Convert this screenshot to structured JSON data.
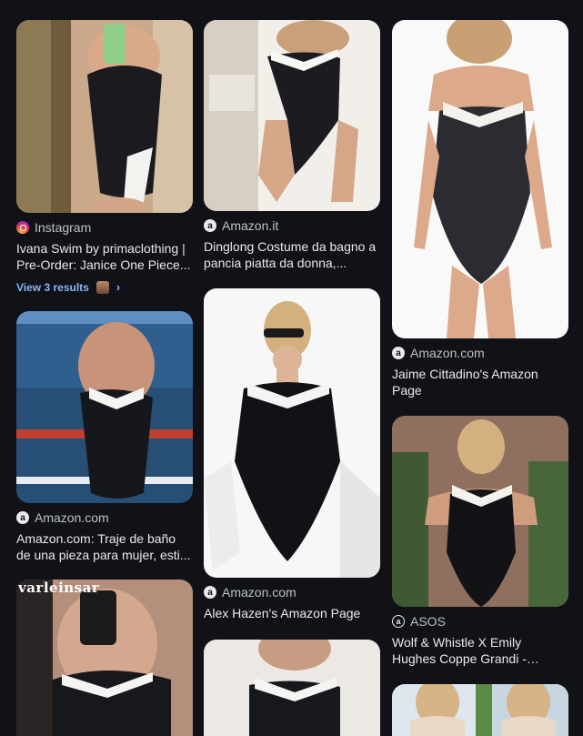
{
  "results": [
    {
      "source": "Instagram",
      "source_icon": "instagram-icon",
      "title": "Ivana Swim by primaclothing | Pre-Order: Janice One Piece...",
      "more": "View 3 results"
    },
    {
      "source": "Amazon.com",
      "source_icon": "amazon-icon",
      "title": "Amazon.com: Traje de baño de una pieza para mujer, esti..."
    },
    {
      "overlay": "varleinsar"
    },
    {
      "source": "Amazon.it",
      "source_icon": "amazon-icon",
      "title": "Dinglong Costume da bagno a pancia piatta da donna,..."
    },
    {
      "source": "Amazon.com",
      "source_icon": "amazon-icon",
      "title": "Alex Hazen's Amazon Page"
    },
    {},
    {
      "source": "Amazon.com",
      "source_icon": "amazon-icon",
      "title": "Jaime Cittadino's Amazon Page"
    },
    {
      "source": "ASOS",
      "source_icon": "asos-icon",
      "title": "Wolf & Whistle X Emily Hughes Coppe Grandi - Costume da..."
    },
    {}
  ],
  "colors": {
    "background": "#101218",
    "link": "#8ab4f8",
    "text": "#e8eaed",
    "muted": "#bdc1c6"
  }
}
